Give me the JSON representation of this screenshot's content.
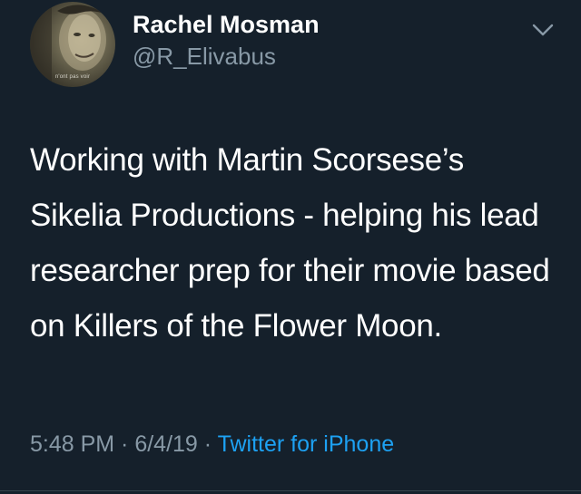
{
  "tweet": {
    "author": {
      "display_name": "Rachel Mosman",
      "handle": "@R_Elivabus",
      "avatar_caption": "n'ont pas voir"
    },
    "text": "Working with Martin Scorsese’s Sikelia Productions - helping his lead researcher prep for their movie based on Killers of the Flower Moon.",
    "time": "5:48 PM",
    "separator": " · ",
    "date": "6/4/19",
    "source": "Twitter for iPhone",
    "menu_icon": "chevron-down-icon"
  },
  "colors": {
    "background": "#15202b",
    "primary_text": "#ffffff",
    "secondary_text": "#8899a6",
    "link": "#1da1f2",
    "divider": "#38444d"
  }
}
